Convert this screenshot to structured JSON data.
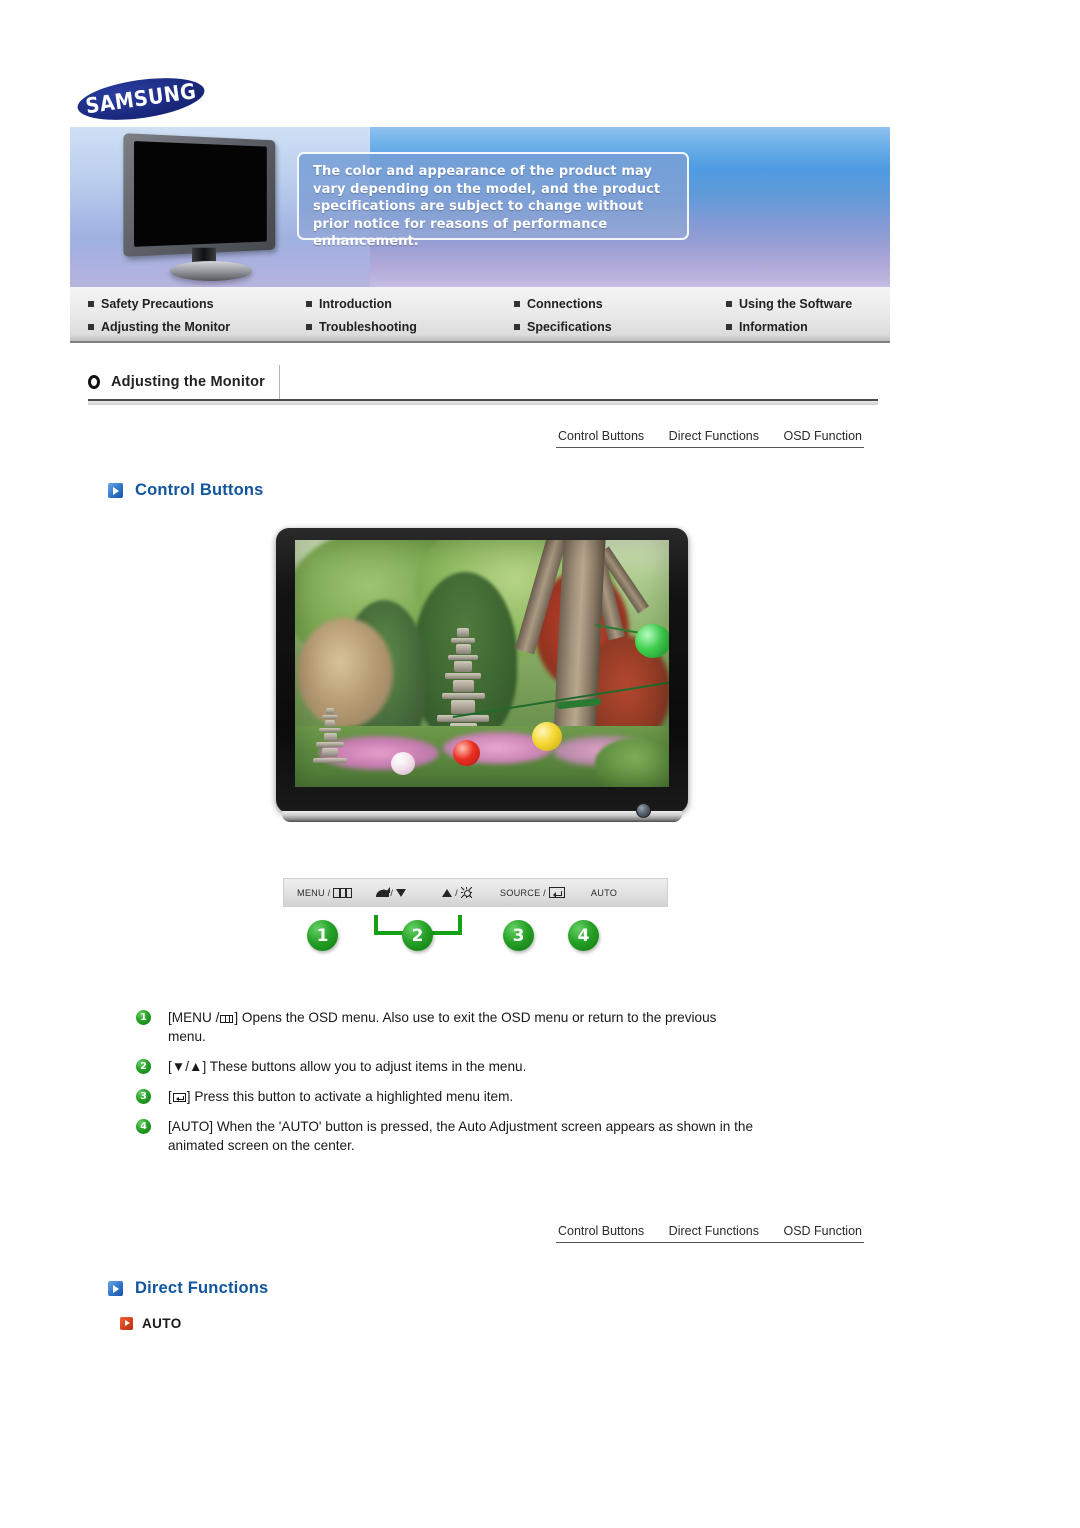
{
  "brand": {
    "logo_text": "SAMSUNG"
  },
  "banner": {
    "notice": "The color and appearance of the product may vary depending on the model, and the product specifications are subject to change without prior notice for reasons of performance enhancement."
  },
  "nav": {
    "items": [
      {
        "label": "Safety Precautions"
      },
      {
        "label": "Introduction"
      },
      {
        "label": "Connections"
      },
      {
        "label": "Using the Software"
      },
      {
        "label": "Adjusting the Monitor"
      },
      {
        "label": "Troubleshooting"
      },
      {
        "label": "Specifications"
      },
      {
        "label": "Information"
      }
    ]
  },
  "section": {
    "icon": "circle-o-icon",
    "title": "Adjusting the Monitor"
  },
  "crumbs": [
    {
      "label": "Control Buttons"
    },
    {
      "label": "Direct Functions"
    },
    {
      "label": "OSD Function"
    }
  ],
  "headings": {
    "control_buttons": "Control Buttons",
    "direct_functions": "Direct Functions"
  },
  "control_strip": {
    "buttons": [
      {
        "label": "MENU /",
        "icon": "menu-osd-icon"
      },
      {
        "label": "/",
        "icon": "magnifier-down-icon"
      },
      {
        "label": "/",
        "icon": "up-brightness-icon"
      },
      {
        "label": "SOURCE /",
        "icon": "enter-icon"
      },
      {
        "label": "AUTO",
        "icon": ""
      }
    ]
  },
  "callout_numbers": [
    {
      "n": "1"
    },
    {
      "n": "2"
    },
    {
      "n": "3"
    },
    {
      "n": "4"
    }
  ],
  "descriptions": [
    {
      "n": "1",
      "pre": "[MENU /",
      "post": "] Opens the OSD menu. Also use to exit the OSD menu or return to the previous menu.",
      "icon": "menu-osd-icon"
    },
    {
      "n": "2",
      "pre": "[▼/▲] These buttons allow you to adjust items in the menu.",
      "post": "",
      "icon": ""
    },
    {
      "n": "3",
      "pre": "[",
      "post": "] Press this button to activate a highlighted menu item.",
      "icon": "enter-icon"
    },
    {
      "n": "4",
      "pre": "[AUTO] When the 'AUTO' button is pressed, the Auto Adjustment screen appears as shown in the animated screen on the center.",
      "post": "",
      "icon": ""
    }
  ],
  "direct_functions": {
    "items": [
      {
        "label": "AUTO"
      }
    ]
  },
  "colors": {
    "heading_blue": "#11559e",
    "badge_green": "#27a127",
    "auto_orange": "#d8401d",
    "logo_blue": "#1b2a80"
  }
}
